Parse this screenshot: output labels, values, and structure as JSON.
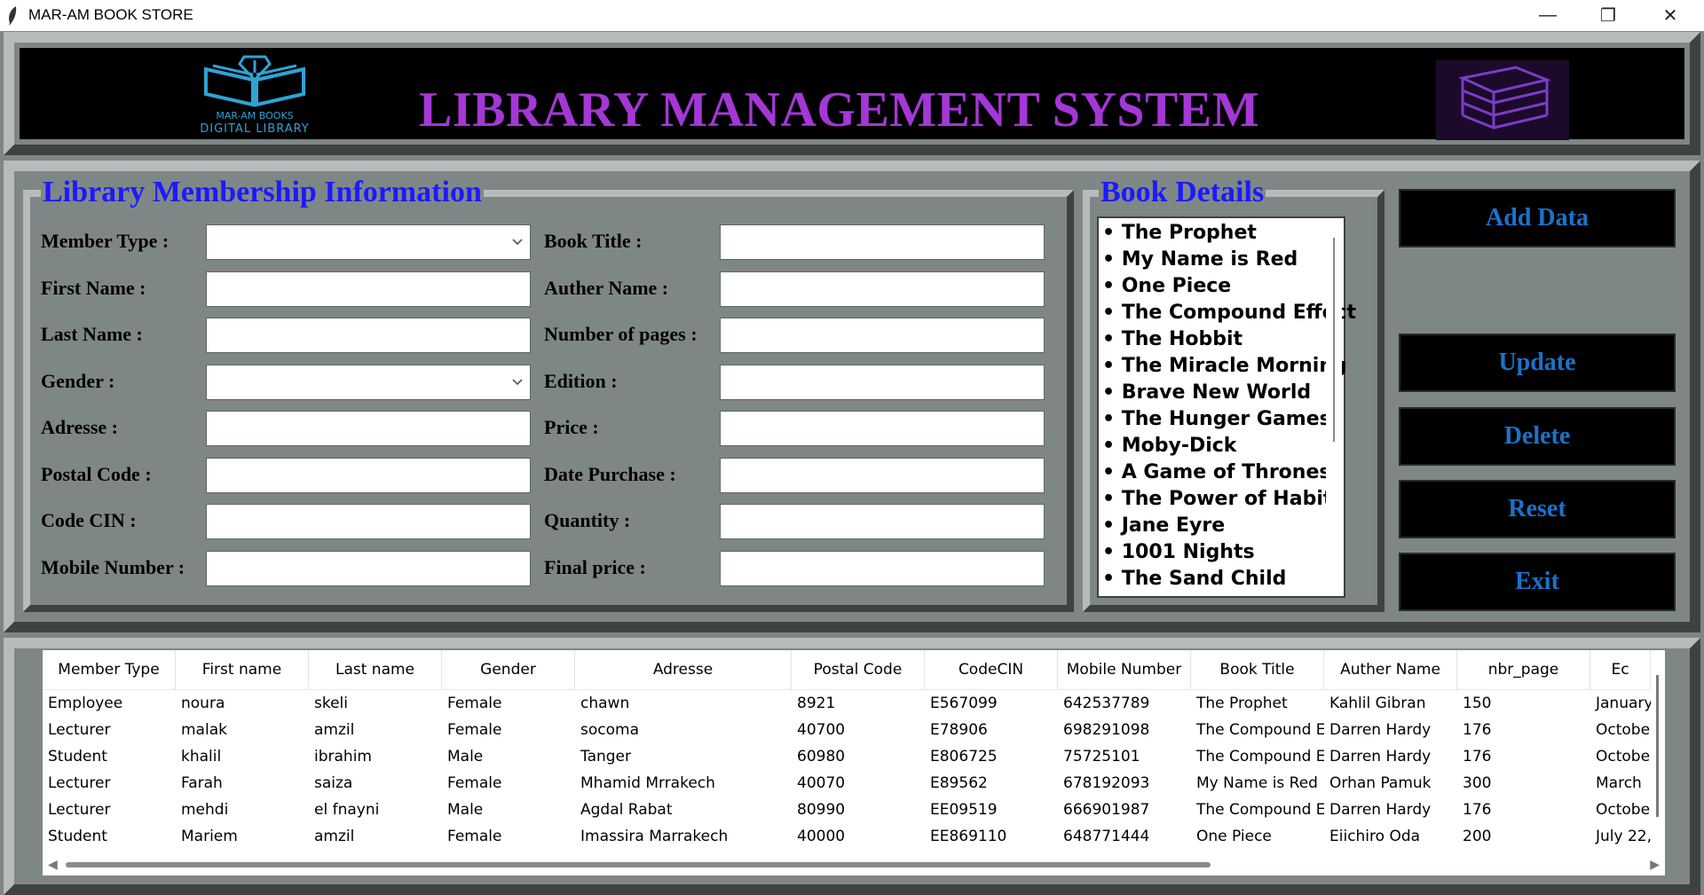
{
  "window": {
    "title": "MAR-AM BOOK STORE",
    "minimize": "—",
    "maximize": "❐",
    "close": "✕"
  },
  "header": {
    "title": "LIBRARY MANAGEMENT SYSTEM",
    "logo_line1": "MAR-AM BOOKS",
    "logo_line2": "DIGITAL LIBRARY"
  },
  "membership": {
    "title": "Library Membership Information",
    "fields": [
      {
        "label": "Member Type :",
        "value": "",
        "type": "combo"
      },
      {
        "label": "First Name :",
        "value": ""
      },
      {
        "label": "Last Name :",
        "value": ""
      },
      {
        "label": "Gender :",
        "value": "",
        "type": "combo"
      },
      {
        "label": "Adresse :",
        "value": ""
      },
      {
        "label": "Postal Code :",
        "value": ""
      },
      {
        "label": "Code CIN :",
        "value": ""
      },
      {
        "label": "Mobile Number :",
        "value": ""
      }
    ],
    "book_fields": [
      {
        "label": "Book Title :",
        "value": ""
      },
      {
        "label": "Auther Name :",
        "value": ""
      },
      {
        "label": "Number of pages :",
        "value": ""
      },
      {
        "label": "Edition :",
        "value": ""
      },
      {
        "label": "Price :",
        "value": ""
      },
      {
        "label": "Date Purchase :",
        "value": ""
      },
      {
        "label": "Quantity :",
        "value": ""
      },
      {
        "label": "Final price :",
        "value": ""
      }
    ]
  },
  "book_details": {
    "title": "Book Details",
    "books": [
      "• The Prophet",
      "• My Name is Red",
      "• One Piece",
      "• The Compound Effect",
      "• The Hobbit",
      "• The Miracle Morning",
      "• Brave New World",
      "• The Hunger Games",
      "• Moby-Dick",
      "• A Game of Thrones",
      "• The Power of Habit",
      "• Jane Eyre",
      "• 1001 Nights",
      "• The Sand Child"
    ]
  },
  "buttons": {
    "add": "Add Data",
    "update": "Update",
    "delete": "Delete",
    "reset": "Reset",
    "exit": "Exit"
  },
  "table": {
    "columns": [
      "Member Type",
      "First name",
      "Last name",
      "Gender",
      "Adresse",
      "Postal Code",
      "CodeCIN",
      "Mobile Number",
      "Book Title",
      "Auther Name",
      "nbr_page",
      "Ec"
    ],
    "rows": [
      [
        "Employee",
        "noura",
        "skeli",
        "Female",
        "chawn",
        "8921",
        "E567099",
        "642537789",
        "The Prophet",
        "Kahlil Gibran",
        "150",
        "January"
      ],
      [
        "Lecturer",
        "malak",
        "amzil",
        "Female",
        "socoma",
        "40700",
        "E78906",
        "698291098",
        "The Compound E",
        "Darren Hardy",
        "176",
        "Octobe"
      ],
      [
        "Student",
        "khalil",
        "ibrahim",
        "Male",
        "Tanger",
        "60980",
        "E806725",
        "75725101",
        "The Compound E",
        "Darren Hardy",
        "176",
        "Octobe"
      ],
      [
        "Lecturer",
        "Farah",
        "saiza",
        "Female",
        "Mhamid Mrrakech",
        "40070",
        "E89562",
        "678192093",
        "My Name is Red",
        "Orhan Pamuk",
        "300",
        "March"
      ],
      [
        "Lecturer",
        "mehdi",
        "el fnayni",
        "Male",
        "Agdal  Rabat",
        "80990",
        "EE09519",
        "666901987",
        "The Compound E",
        "Darren Hardy",
        "176",
        "Octobe"
      ],
      [
        "Student",
        "Mariem",
        "amzil",
        "Female",
        "Imassira Marrakech",
        "40000",
        "EE869110",
        "648771444",
        "One Piece",
        "Eiichiro Oda",
        "200",
        "July 22,"
      ]
    ]
  }
}
